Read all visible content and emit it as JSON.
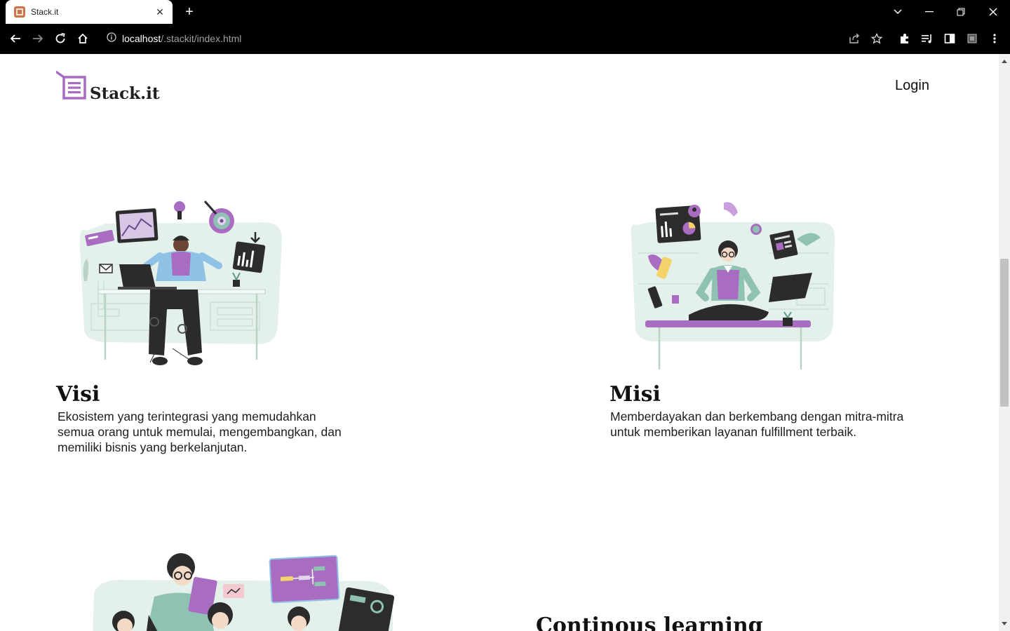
{
  "browser": {
    "tab_title": "Stack.it",
    "url_host": "localhost",
    "url_path": "/.stackit/index.html"
  },
  "header": {
    "brand": "Stack.it",
    "login_label": "Login"
  },
  "sections": [
    {
      "title": "Visi",
      "text": "Ekosistem yang terintegrasi yang memudahkan semua orang untuk memulai, mengembangkan, dan memiliki bisnis yang berkelanjutan."
    },
    {
      "title": "Misi",
      "text": "Memberdayakan dan berkembang dengan mitra-mitra untuk memberikan layanan fulfillment terbaik."
    },
    {
      "title": "Continous learning"
    }
  ],
  "colors": {
    "accent": "#a86cc1",
    "mint": "#dfeee7",
    "dark": "#2b2b2b"
  }
}
